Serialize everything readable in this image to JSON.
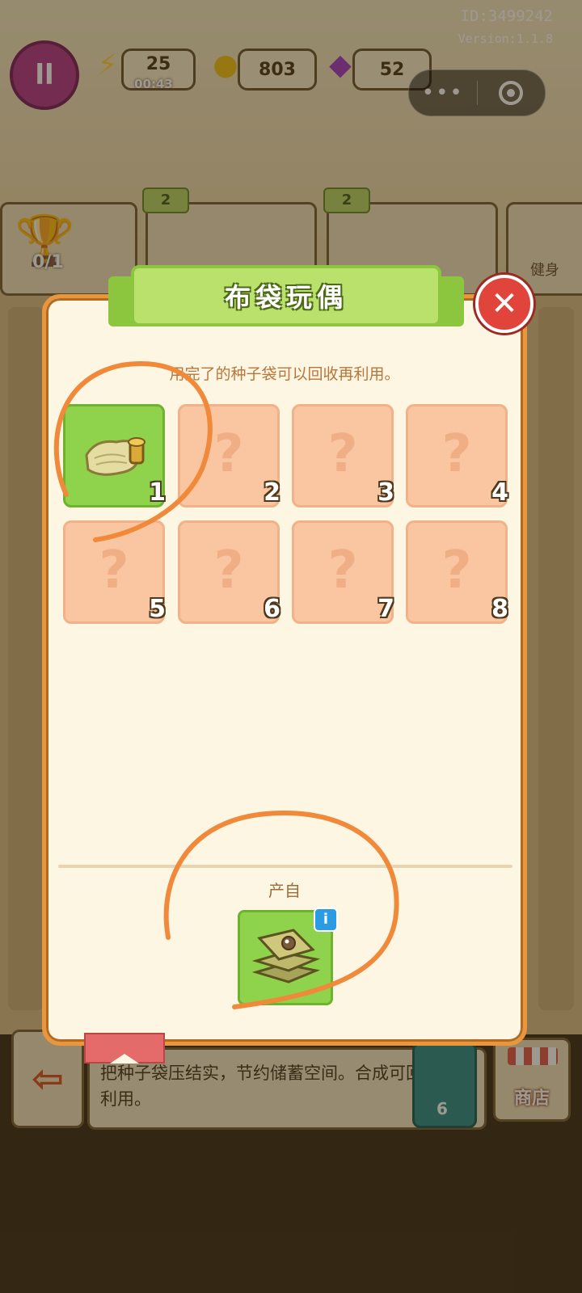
{
  "header": {
    "id_label": "ID:3499242",
    "version_label": "Version:1.1.8"
  },
  "hud": {
    "energy": "25",
    "energy_timer": "00:43",
    "coins": "803",
    "gems": "52"
  },
  "shelf": {
    "trophy_count": "0/1",
    "badge_left": "2",
    "badge_right": "2",
    "right_label": "健身"
  },
  "modal": {
    "title": "布袋玩偶",
    "subtitle": "用完了的种子袋可以回收再利用。",
    "slots": [
      {
        "number": "1",
        "state": "unlocked"
      },
      {
        "number": "2",
        "state": "locked"
      },
      {
        "number": "3",
        "state": "locked"
      },
      {
        "number": "4",
        "state": "locked"
      },
      {
        "number": "5",
        "state": "locked"
      },
      {
        "number": "6",
        "state": "locked"
      },
      {
        "number": "7",
        "state": "locked"
      },
      {
        "number": "8",
        "state": "locked"
      }
    ],
    "locked_glyph": "?",
    "source_label": "产自",
    "info_glyph": "i",
    "close_glyph": "✕"
  },
  "bottom": {
    "description": "把种子袋压结实，节约储蓄空间。合成可回收再利用。",
    "coin_cost": "6",
    "shop_label": "商店"
  },
  "colors": {
    "modal_border": "#e9963d",
    "banner_green": "#b9e16b",
    "slot_locked": "#f9c6a1",
    "slot_unlocked": "#8fd24b",
    "close_red": "#e0443a",
    "annotation_orange": "#f0893a"
  }
}
